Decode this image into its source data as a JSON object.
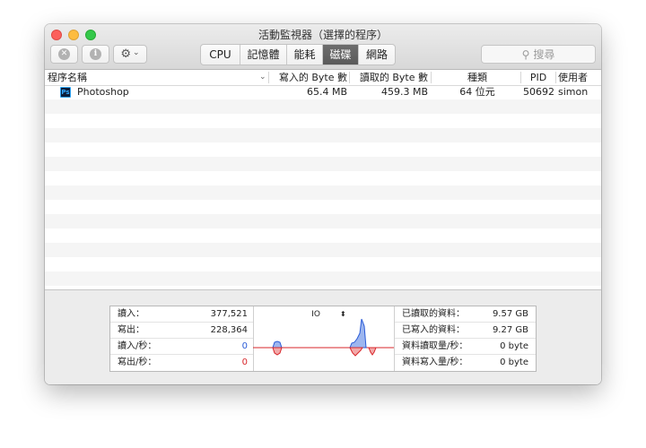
{
  "window": {
    "title": "活動監視器（選擇的程序）"
  },
  "toolbar": {
    "stop_icon": "close-circle-icon",
    "info_icon": "info-icon",
    "gear_icon": "gear-icon",
    "gear_chevron": "⌄",
    "tabs": [
      {
        "label": "CPU",
        "active": false
      },
      {
        "label": "記憶體",
        "active": false
      },
      {
        "label": "能耗",
        "active": false
      },
      {
        "label": "磁碟",
        "active": true
      },
      {
        "label": "網路",
        "active": false
      }
    ],
    "search_placeholder": "搜尋"
  },
  "table": {
    "columns": [
      "程序名稱",
      "寫入的 Byte 數",
      "讀取的 Byte 數",
      "種類",
      "PID",
      "使用者"
    ],
    "rows": [
      {
        "name": "Photoshop",
        "icon": "Ps",
        "bytes_written": "65.4 MB",
        "bytes_read": "459.3 MB",
        "kind": "64 位元",
        "pid": "50692",
        "user": "simon"
      }
    ]
  },
  "stats": {
    "left": [
      {
        "label": "讀入：",
        "value": "377,521"
      },
      {
        "label": "寫出：",
        "value": "228,364"
      },
      {
        "label": "讀入/秒：",
        "value": "0"
      },
      {
        "label": "寫出/秒：",
        "value": "0"
      }
    ],
    "right": [
      {
        "label": "已讀取的資料：",
        "value": "9.57 GB"
      },
      {
        "label": "已寫入的資料：",
        "value": "9.27 GB"
      },
      {
        "label": "資料讀取量/秒：",
        "value": "0 byte"
      },
      {
        "label": "資料寫入量/秒：",
        "value": "0 byte"
      }
    ],
    "graph_label": "IO",
    "graph_selector": "⌃⌄"
  },
  "colors": {
    "read": "#2a5bd7",
    "write": "#d8262a",
    "read_fill": "#9db6ef",
    "write_fill": "#f2a9a9",
    "active_tab": "#5f5f5f"
  }
}
